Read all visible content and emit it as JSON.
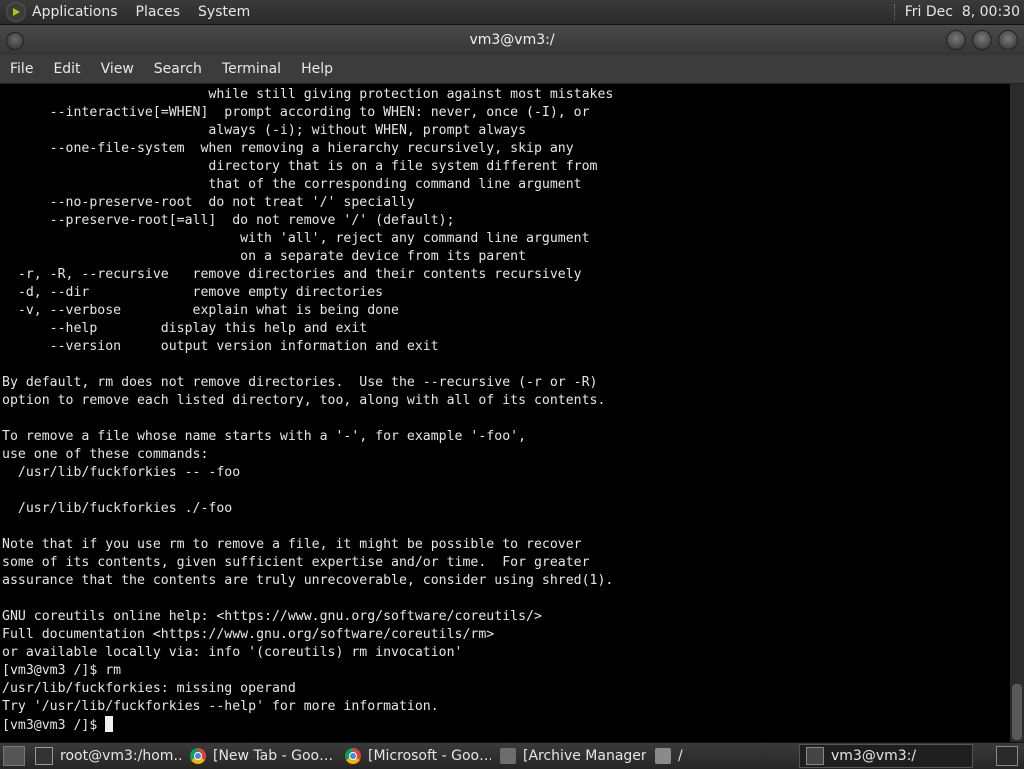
{
  "top_panel": {
    "menus": [
      "Applications",
      "Places",
      "System"
    ],
    "clock": "Fri Dec  8, 00:30"
  },
  "window": {
    "title": "vm3@vm3:/"
  },
  "menubar": {
    "items": [
      "File",
      "Edit",
      "View",
      "Search",
      "Terminal",
      "Help"
    ]
  },
  "terminal": {
    "lines": [
      "                          while still giving protection against most mistakes",
      "      --interactive[=WHEN]  prompt according to WHEN: never, once (-I), or",
      "                          always (-i); without WHEN, prompt always",
      "      --one-file-system  when removing a hierarchy recursively, skip any",
      "                          directory that is on a file system different from",
      "                          that of the corresponding command line argument",
      "      --no-preserve-root  do not treat '/' specially",
      "      --preserve-root[=all]  do not remove '/' (default);",
      "                              with 'all', reject any command line argument",
      "                              on a separate device from its parent",
      "  -r, -R, --recursive   remove directories and their contents recursively",
      "  -d, --dir             remove empty directories",
      "  -v, --verbose         explain what is being done",
      "      --help        display this help and exit",
      "      --version     output version information and exit",
      "",
      "By default, rm does not remove directories.  Use the --recursive (-r or -R)",
      "option to remove each listed directory, too, along with all of its contents.",
      "",
      "To remove a file whose name starts with a '-', for example '-foo',",
      "use one of these commands:",
      "  /usr/lib/fuckforkies -- -foo",
      "",
      "  /usr/lib/fuckforkies ./-foo",
      "",
      "Note that if you use rm to remove a file, it might be possible to recover",
      "some of its contents, given sufficient expertise and/or time.  For greater",
      "assurance that the contents are truly unrecoverable, consider using shred(1).",
      "",
      "GNU coreutils online help: <https://www.gnu.org/software/coreutils/>",
      "Full documentation <https://www.gnu.org/software/coreutils/rm>",
      "or available locally via: info '(coreutils) rm invocation'",
      "[vm3@vm3 /]$ rm",
      "/usr/lib/fuckforkies: missing operand",
      "Try '/usr/lib/fuckforkies --help' for more information."
    ],
    "prompt": "[vm3@vm3 /]$ "
  },
  "taskbar": {
    "tasks": [
      {
        "label": "root@vm3:/hom…",
        "icon": "terminal-icon"
      },
      {
        "label": "[New Tab - Goo…",
        "icon": "chrome-icon"
      },
      {
        "label": "[Microsoft - Goo…",
        "icon": "chrome-icon"
      },
      {
        "label": "[Archive Manager]",
        "icon": "archive-icon"
      },
      {
        "label": "/",
        "icon": "folder-icon"
      },
      {
        "label": "vm3@vm3:/",
        "icon": "terminal-icon",
        "active": true
      }
    ]
  }
}
